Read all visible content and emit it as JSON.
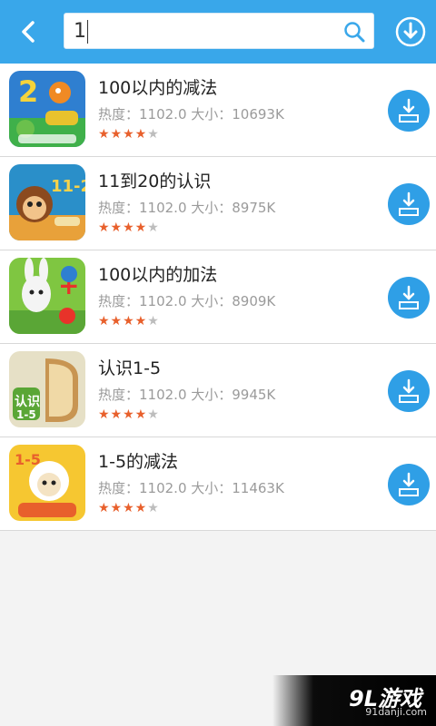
{
  "search": {
    "value": "1"
  },
  "accent": "#39a7ea",
  "apps": [
    {
      "title": "100以内的减法",
      "meta": "热度：1102.0  大小：10693K",
      "rating": 4
    },
    {
      "title": "11到20的认识",
      "meta": "热度：1102.0  大小：8975K",
      "rating": 4
    },
    {
      "title": "100以内的加法",
      "meta": "热度：1102.0  大小：8909K",
      "rating": 4
    },
    {
      "title": "认识1-5",
      "meta": "热度：1102.0  大小：9945K",
      "rating": 4
    },
    {
      "title": "1-5的减法",
      "meta": "热度：1102.0  大小：11463K",
      "rating": 4
    }
  ],
  "icons": {
    "back": "chevron-left-icon",
    "search": "search-icon",
    "download": "download-icon"
  },
  "watermark": {
    "logo": "9L游戏",
    "url": "91danji.com"
  }
}
